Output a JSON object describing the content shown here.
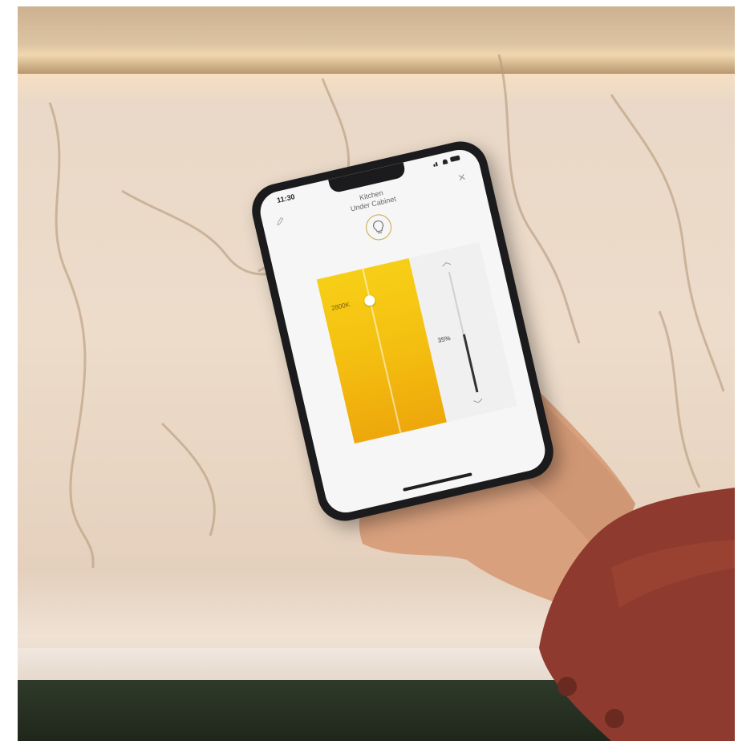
{
  "status_bar": {
    "time": "11:30"
  },
  "light": {
    "room": "Kitchen",
    "name": "Under Cabinet"
  },
  "color_temperature": {
    "label": "2800K"
  },
  "brightness": {
    "label": "35%",
    "level_percent": 35
  },
  "colors": {
    "panel_gradient_top": "#f7cf17",
    "panel_gradient_bottom": "#eea70c",
    "icon_ring": "#c9a64c",
    "phone_frame": "#1b1b1d",
    "sleeve": "#8e3a2e"
  },
  "icons": [
    "edit-icon",
    "close-icon",
    "light-bulb-icon",
    "chevron-up-icon",
    "chevron-down-icon"
  ]
}
